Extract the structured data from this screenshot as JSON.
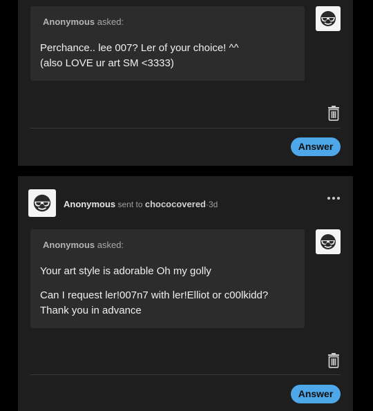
{
  "posts": [
    {
      "asker": {
        "name": "Anonymous",
        "suffix": " asked:"
      },
      "question_lines": [
        "Perchance.. lee 007? Ler of your choice! ^^",
        "(also LOVE ur art SM <3333)"
      ],
      "answer_label": "Answer",
      "avatar_icon": "sunglasses-smiley-icon",
      "delete_icon": "trash-icon"
    },
    {
      "header": {
        "sender": "Anonymous",
        "sent_to": "sent to",
        "recipient": "chococovered",
        "separator": "·",
        "age": "3d"
      },
      "asker": {
        "name": "Anonymous",
        "suffix": " asked:"
      },
      "question_paragraphs": [
        [
          "Your art style is adorable Oh my golly"
        ],
        [
          "Can I request ler!007n7 with ler!Elliot or c00lkidd?",
          "Thank you in advance"
        ]
      ],
      "answer_label": "Answer",
      "avatar_icon": "sunglasses-smiley-icon",
      "delete_icon": "trash-icon",
      "more_icon": "more-options-icon"
    }
  ],
  "colors": {
    "page_background": "#000000",
    "card_background": "#1e1e1e",
    "bubble_background": "#2c2c2c",
    "accent": "#4ea7e8",
    "secondary_text": "#a8a8a8"
  }
}
